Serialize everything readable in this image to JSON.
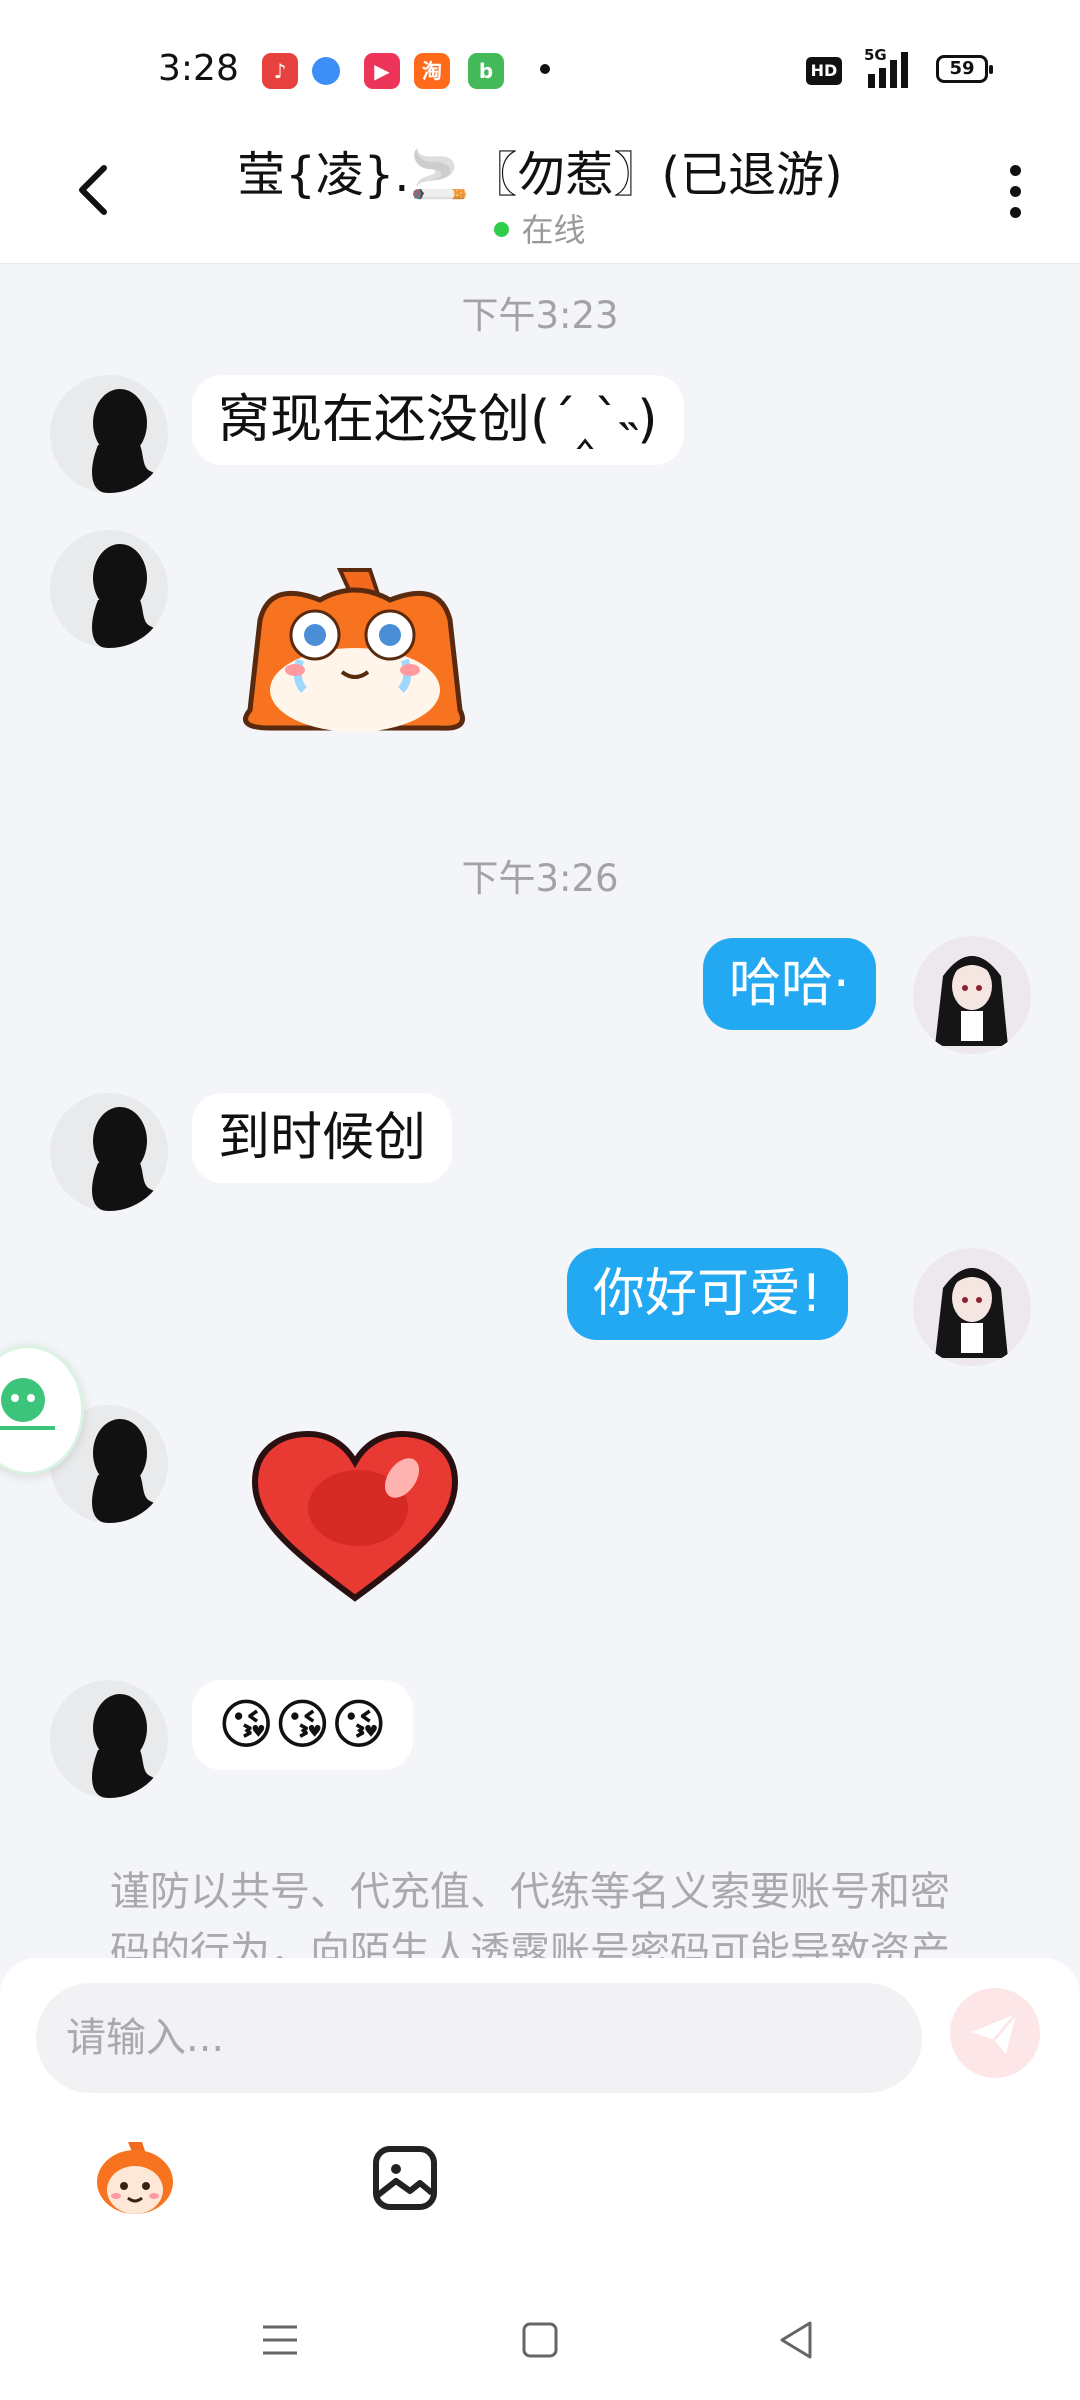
{
  "status_bar": {
    "time": "3:28",
    "network": "5G",
    "hd": "HD",
    "battery": "59"
  },
  "header": {
    "title": "莹{凌}.🚬〖勿惹〗(已退游)",
    "status": "在线"
  },
  "chat": {
    "timestamp_1": "下午3:23",
    "msg_1": "窝现在还没创(ˊ‸ˋ˵)",
    "timestamp_2": "下午3:26",
    "msg_2": "哈哈·",
    "msg_3": "到时候创",
    "msg_4": "你好可爱!",
    "msg_5": "😘😘😘",
    "notice": "谨防以共号、代充值、代练等名义索要账号和密码的行为，向陌生人透露账号密码可能导致资产"
  },
  "input": {
    "placeholder": "请输入..."
  },
  "colors": {
    "accent": "#23a8f2",
    "online": "#2ecc4a"
  },
  "icons": [
    "back-icon",
    "more-icon",
    "send-icon",
    "emoji-icon",
    "image-icon",
    "menu-icon",
    "home-icon",
    "back-nav-icon"
  ]
}
